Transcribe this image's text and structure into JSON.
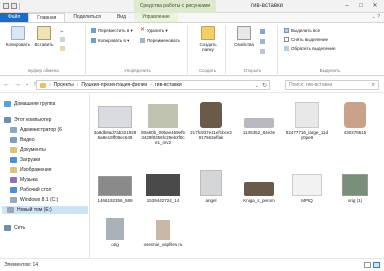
{
  "window": {
    "title": "гив-вставки",
    "context_tab_label": "Средства работы с рисунками",
    "controls": [
      "–",
      "□",
      "✕"
    ]
  },
  "tabs": [
    {
      "label": "Файл"
    },
    {
      "label": "Главная"
    },
    {
      "label": "Поделиться"
    },
    {
      "label": "Вид"
    },
    {
      "label": "Управление"
    }
  ],
  "ribbon": {
    "clipboard": {
      "group_label": "Буфер обмена",
      "copy_path": "Копировать путь",
      "copy": "Копировать",
      "paste": "Вставить"
    },
    "organize": {
      "group_label": "Упорядочить",
      "move_to": "Переместить в ▾",
      "copy_to": "Копировать в ▾",
      "delete": "Удалить ▾",
      "rename": "Переименовать"
    },
    "new": {
      "group_label": "Создать",
      "new_folder": "Создать папку"
    },
    "open": {
      "group_label": "Открыть",
      "properties": "Свойства"
    },
    "select": {
      "group_label": "Выделить",
      "select_all": "Выделить все",
      "select_none": "Снять выделение",
      "invert": "Обратить выделение"
    }
  },
  "address": {
    "path": [
      "Проекты",
      "Пушкин-презентация-филин",
      "гив-вставки"
    ],
    "search_placeholder": "Поиск: гив-вставки"
  },
  "navpane": {
    "items": [
      {
        "label": "Домашняя группа",
        "color": "#5aa0d8"
      },
      {
        "label": "Этот компьютер",
        "color": "#6f8fae"
      },
      {
        "label": "Администратор (6",
        "color": "#8aa6c0"
      },
      {
        "label": "Видео",
        "color": "#7c9fbf"
      },
      {
        "label": "Документы",
        "color": "#d9c27a"
      },
      {
        "label": "Загрузки",
        "color": "#4d8fd0"
      },
      {
        "label": "Изображения",
        "color": "#d9c27a"
      },
      {
        "label": "Музыка",
        "color": "#8f6fbf"
      },
      {
        "label": "Рабочий стол",
        "color": "#4d8fd0"
      },
      {
        "label": "Windows 8.1 (C:)",
        "color": "#9aa7b4"
      },
      {
        "label": "Новый том (E:)",
        "color": "#9aa7b4"
      },
      {
        "label": "Сеть",
        "color": "#6f8fae"
      }
    ]
  },
  "files": [
    {
      "name": "3a9db8ad7ab3219285a8e19ff08ec649",
      "color": "#d9dbe0"
    },
    {
      "name": "80a80b_09bae469ef53429f8356fc29eb2f0ce1_mv2",
      "color": "#bfc3b0"
    },
    {
      "name": "217fc937e11ef1bce2917563effak",
      "color": "#6a5a4a"
    },
    {
      "name": "1135352_84e3e",
      "color": "#b8b9bf"
    },
    {
      "name": "82477716_large_11dy0pe9",
      "color": "#e8e8e8"
    },
    {
      "name": "430278615",
      "color": "#caa28a"
    },
    {
      "name": "1466192356_589",
      "color": "#8a8a8a"
    },
    {
      "name": "1539442724_14",
      "color": "#4a4a4a"
    },
    {
      "name": "angel",
      "color": "#d4d6d8"
    },
    {
      "name": "Kniga_s_perom",
      "color": "#6b5a4a"
    },
    {
      "name": "MPtQ",
      "color": "#f2f2f2"
    },
    {
      "name": "orig (1)",
      "color": "#7a8f7a"
    },
    {
      "name": "orig",
      "color": "#a8b0b8"
    },
    {
      "name": "osennie_vapfiles.ru",
      "color": "#c8b8a8"
    }
  ],
  "status": {
    "count": "Элементов: 14"
  }
}
